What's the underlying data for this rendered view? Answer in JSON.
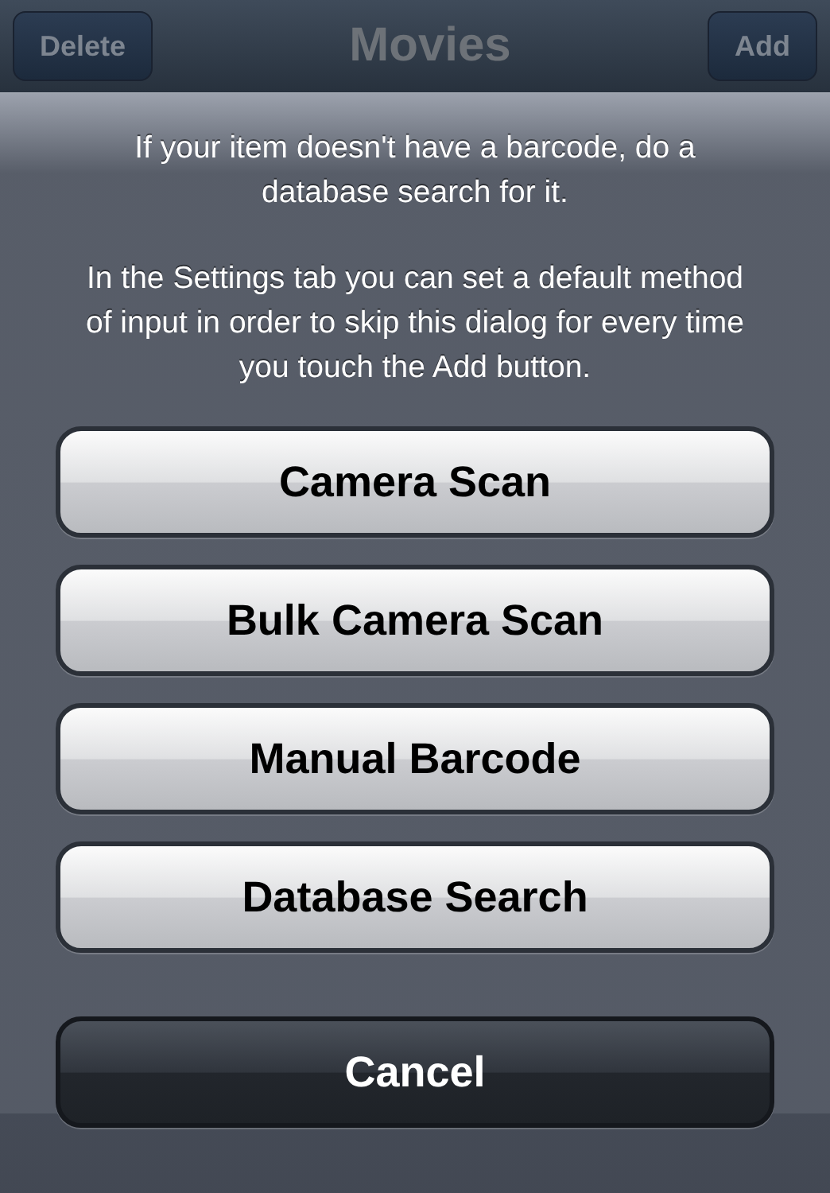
{
  "nav_bar": {
    "left_button": "Delete",
    "title": "Movies",
    "right_button": "Add"
  },
  "action_sheet": {
    "messages": [
      "If your item doesn't have a barcode, do a database search for it.",
      "In the Settings tab you can set a default method of input in order to skip this dialog for every time you touch the Add button."
    ],
    "buttons": [
      {
        "label": "Camera Scan",
        "kind": "default"
      },
      {
        "label": "Bulk Camera Scan",
        "kind": "default"
      },
      {
        "label": "Manual Barcode",
        "kind": "default"
      },
      {
        "label": "Database Search",
        "kind": "default"
      },
      {
        "label": "Cancel",
        "kind": "cancel"
      }
    ]
  }
}
